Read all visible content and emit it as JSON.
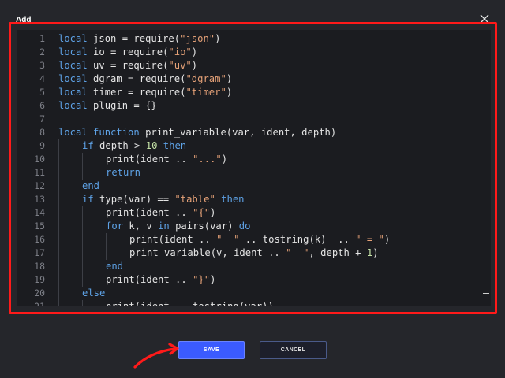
{
  "dialog": {
    "title": "Add"
  },
  "editor": {
    "lines": [
      {
        "n": "1",
        "indent": 0,
        "tokens": [
          {
            "t": "local",
            "c": "kw"
          },
          {
            "t": " json = require(",
            "c": "plain"
          },
          {
            "t": "\"json\"",
            "c": "str"
          },
          {
            "t": ")",
            "c": "plain"
          }
        ]
      },
      {
        "n": "2",
        "indent": 0,
        "tokens": [
          {
            "t": "local",
            "c": "kw"
          },
          {
            "t": " io = require(",
            "c": "plain"
          },
          {
            "t": "\"io\"",
            "c": "str"
          },
          {
            "t": ")",
            "c": "plain"
          }
        ]
      },
      {
        "n": "3",
        "indent": 0,
        "tokens": [
          {
            "t": "local",
            "c": "kw"
          },
          {
            "t": " uv = require(",
            "c": "plain"
          },
          {
            "t": "\"uv\"",
            "c": "str"
          },
          {
            "t": ")",
            "c": "plain"
          }
        ]
      },
      {
        "n": "4",
        "indent": 0,
        "tokens": [
          {
            "t": "local",
            "c": "kw"
          },
          {
            "t": " dgram = require(",
            "c": "plain"
          },
          {
            "t": "\"dgram\"",
            "c": "str"
          },
          {
            "t": ")",
            "c": "plain"
          }
        ]
      },
      {
        "n": "5",
        "indent": 0,
        "tokens": [
          {
            "t": "local",
            "c": "kw"
          },
          {
            "t": " timer = require(",
            "c": "plain"
          },
          {
            "t": "\"timer\"",
            "c": "str"
          },
          {
            "t": ")",
            "c": "plain"
          }
        ]
      },
      {
        "n": "6",
        "indent": 0,
        "tokens": [
          {
            "t": "local",
            "c": "kw"
          },
          {
            "t": " plugin = {}",
            "c": "plain"
          }
        ]
      },
      {
        "n": "7",
        "indent": 0,
        "tokens": []
      },
      {
        "n": "8",
        "indent": 0,
        "tokens": [
          {
            "t": "local",
            "c": "kw"
          },
          {
            "t": " ",
            "c": "plain"
          },
          {
            "t": "function",
            "c": "kw"
          },
          {
            "t": " print_variable(var, ident, depth)",
            "c": "plain"
          }
        ]
      },
      {
        "n": "9",
        "indent": 1,
        "tokens": [
          {
            "t": "if",
            "c": "kw"
          },
          {
            "t": " depth > ",
            "c": "plain"
          },
          {
            "t": "10",
            "c": "num"
          },
          {
            "t": " ",
            "c": "plain"
          },
          {
            "t": "then",
            "c": "kw"
          }
        ]
      },
      {
        "n": "10",
        "indent": 2,
        "tokens": [
          {
            "t": "print(ident .. ",
            "c": "plain"
          },
          {
            "t": "\"...\"",
            "c": "str"
          },
          {
            "t": ")",
            "c": "plain"
          }
        ]
      },
      {
        "n": "11",
        "indent": 2,
        "tokens": [
          {
            "t": "return",
            "c": "kw"
          }
        ]
      },
      {
        "n": "12",
        "indent": 1,
        "tokens": [
          {
            "t": "end",
            "c": "kw"
          }
        ]
      },
      {
        "n": "13",
        "indent": 1,
        "tokens": [
          {
            "t": "if",
            "c": "kw"
          },
          {
            "t": " type(var) == ",
            "c": "plain"
          },
          {
            "t": "\"table\"",
            "c": "str"
          },
          {
            "t": " ",
            "c": "plain"
          },
          {
            "t": "then",
            "c": "kw"
          }
        ]
      },
      {
        "n": "14",
        "indent": 2,
        "tokens": [
          {
            "t": "print(ident .. ",
            "c": "plain"
          },
          {
            "t": "\"{\"",
            "c": "str"
          },
          {
            "t": ")",
            "c": "plain"
          }
        ]
      },
      {
        "n": "15",
        "indent": 2,
        "tokens": [
          {
            "t": "for",
            "c": "kw"
          },
          {
            "t": " k, v ",
            "c": "plain"
          },
          {
            "t": "in",
            "c": "kw"
          },
          {
            "t": " pairs(var) ",
            "c": "plain"
          },
          {
            "t": "do",
            "c": "kw"
          }
        ]
      },
      {
        "n": "16",
        "indent": 3,
        "tokens": [
          {
            "t": "print(ident .. ",
            "c": "plain"
          },
          {
            "t": "\"  \"",
            "c": "str"
          },
          {
            "t": " .. tostring(k)  .. ",
            "c": "plain"
          },
          {
            "t": "\" = \"",
            "c": "str"
          },
          {
            "t": ")",
            "c": "plain"
          }
        ]
      },
      {
        "n": "17",
        "indent": 3,
        "tokens": [
          {
            "t": "print_variable(v, ident .. ",
            "c": "plain"
          },
          {
            "t": "\"  \"",
            "c": "str"
          },
          {
            "t": ", depth + ",
            "c": "plain"
          },
          {
            "t": "1",
            "c": "num"
          },
          {
            "t": ")",
            "c": "plain"
          }
        ]
      },
      {
        "n": "18",
        "indent": 2,
        "tokens": [
          {
            "t": "end",
            "c": "kw"
          }
        ]
      },
      {
        "n": "19",
        "indent": 2,
        "tokens": [
          {
            "t": "print(ident .. ",
            "c": "plain"
          },
          {
            "t": "\"}\"",
            "c": "str"
          },
          {
            "t": ")",
            "c": "plain"
          }
        ]
      },
      {
        "n": "20",
        "indent": 1,
        "tokens": [
          {
            "t": "else",
            "c": "kw"
          }
        ]
      },
      {
        "n": "21",
        "indent": 2,
        "tokens": [
          {
            "t": "print(ident .. tostring(var))",
            "c": "plain"
          }
        ]
      }
    ]
  },
  "actions": {
    "save_label": "SAVE",
    "cancel_label": "CANCEL"
  },
  "colors": {
    "background": "#25262b",
    "editor_background": "#1b1c20",
    "highlight_border": "#ff1a1a",
    "save_button": "#3b5bff",
    "keyword": "#5ea2e6",
    "string": "#e5a177",
    "number": "#c4e1a6"
  },
  "icons": {
    "close": "close-icon",
    "annotation": "arrow-annotation-icon"
  }
}
